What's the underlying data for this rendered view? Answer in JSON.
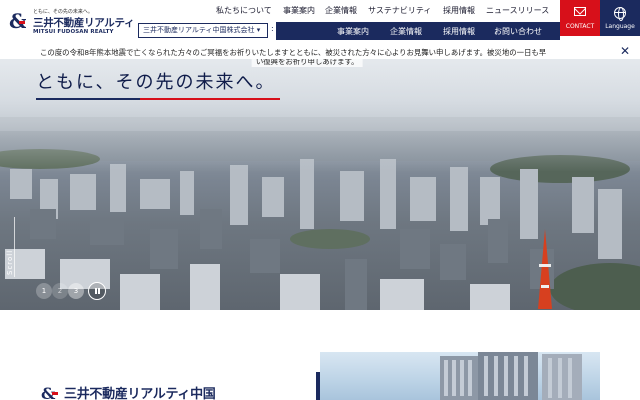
{
  "brand": {
    "tagline": "ともに、その先の未来へ。",
    "name_ja": "三井不動産リアルティ",
    "name_en": "MITSUI FUDOSAN REALTY",
    "colors": {
      "navy": "#1b2a5e",
      "red": "#d7101a"
    }
  },
  "nav_top": [
    "私たちについて",
    "事業案内",
    "企業情報",
    "サステナビリティ",
    "採用情報",
    "ニュースリリース"
  ],
  "company_select": {
    "value": "三井不動産リアルティ中国株式会社 ▾"
  },
  "nav_sub": [
    "事業案内",
    "企業情報",
    "採用情報",
    "お問い合わせ"
  ],
  "contact": {
    "label": "CONTACT",
    "icon": "mail-icon"
  },
  "language": {
    "label": "Language",
    "icon": "globe-icon"
  },
  "notice": {
    "text": "この度の令和8年熊本地震で亡くなられた方々のご冥福をお祈りいたしますとともに、被災された方々に心よりお見舞い申しあげます。被災地の一日も早",
    "continuation": "い復興をお祈り申しあげます。",
    "close_icon": "close-icon"
  },
  "hero": {
    "copy": "ともに、その先の未来へ。",
    "scroll_label": "Scroll",
    "slides": [
      "1",
      "2",
      "3"
    ],
    "current_slide": 3,
    "pause_icon": "pause-icon"
  },
  "lower": {
    "company_name": "三井不動産リアルティ中国"
  }
}
